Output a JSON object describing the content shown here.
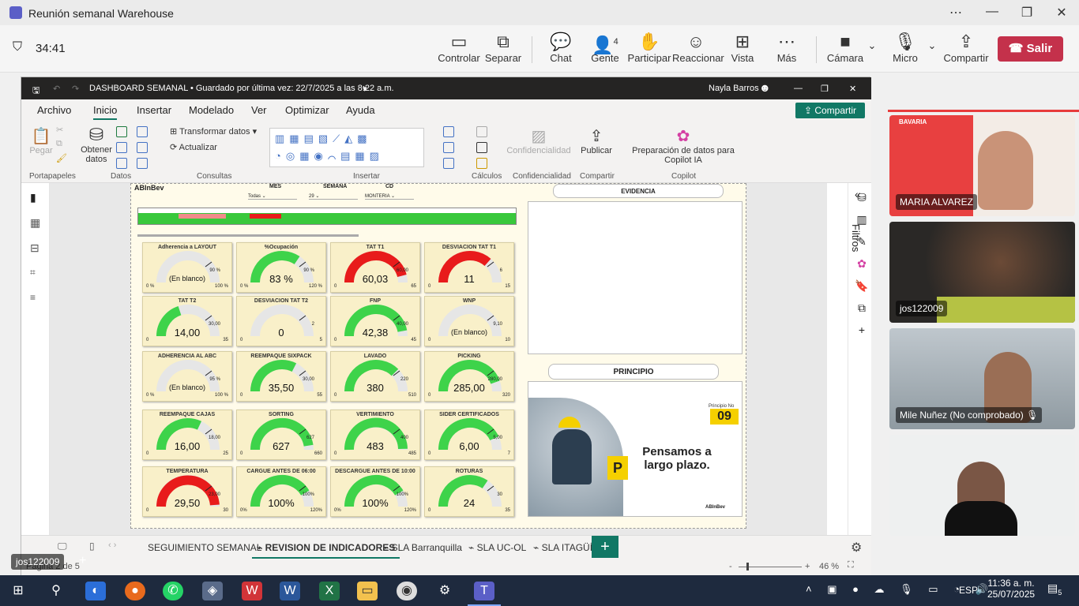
{
  "teams": {
    "window_title": "Reunión semanal Warehouse",
    "timer": "34:41",
    "toolbar": [
      {
        "label": "Controlar",
        "icon": "screen-share-control-icon"
      },
      {
        "label": "Separar",
        "icon": "pop-out-icon"
      },
      {
        "label": "Chat",
        "icon": "chat-icon"
      },
      {
        "label": "Gente",
        "icon": "people-icon",
        "count": "4"
      },
      {
        "label": "Participar",
        "icon": "raise-hand-icon"
      },
      {
        "label": "Reaccionar",
        "icon": "smile-icon"
      },
      {
        "label": "Vista",
        "icon": "grid-view-icon"
      },
      {
        "label": "Más",
        "icon": "more-icon"
      },
      {
        "label": "Cámara",
        "icon": "camera-icon"
      },
      {
        "label": "Micro",
        "icon": "microphone-icon"
      },
      {
        "label": "Compartir",
        "icon": "share-icon"
      }
    ],
    "leave_label": "Salir",
    "participants": [
      {
        "name": "MARIA ALVAREZ"
      },
      {
        "name": "jos122009"
      },
      {
        "name": "Mile Nuñez (No comprobado)"
      },
      {
        "name": ""
      }
    ],
    "presenter_name": "jos122009"
  },
  "pbi": {
    "title": "DASHBOARD SEMANAL • Guardado por última vez: 22/7/2025 a las 8:22 a.m.",
    "user": "Nayla Barros",
    "menu": [
      "Archivo",
      "Inicio",
      "Insertar",
      "Modelado",
      "Ver",
      "Optimizar",
      "Ayuda"
    ],
    "share_label": "Compartir",
    "ribbon": {
      "pegar": "Pegar",
      "obtener": "Obtener datos",
      "transformar": "Transformar datos",
      "actualizar": "Actualizar",
      "confidencialidad": "Confidencialidad",
      "publicar": "Publicar",
      "copilot": "Preparación de datos para Copilot IA",
      "groups": [
        "Portapapeles",
        "Datos",
        "Consultas",
        "Insertar",
        "Cálculos",
        "Confidencialidad",
        "Compartir",
        "Copilot"
      ]
    },
    "filters_label": "Filtros",
    "report": {
      "brand": "ABInBev",
      "slicers": [
        {
          "label": "MES",
          "value": "Todas"
        },
        {
          "label": "SEMANA",
          "value": "29"
        },
        {
          "label": "CD",
          "value": "MONTERIA"
        }
      ],
      "evidencia": "EVIDENCIA",
      "principio": "PRINCIPIO",
      "principio_no": "09",
      "principio_tag": "Principio No",
      "poster_text": "Pensamos a largo plazo.",
      "poster_brand": "ABInBev",
      "gauges": [
        {
          "title": "Adherencia a LAYOUT",
          "value": "(En blanco)",
          "min": "0 %",
          "max": "100 %",
          "target": "90 %",
          "fill": 0,
          "color": "#3ed34a"
        },
        {
          "title": "%Ocupación",
          "value": "83 %",
          "min": "0 %",
          "max": "120 %",
          "target": "90 %",
          "fill": 0.69,
          "color": "#3ed34a"
        },
        {
          "title": "TAT T1",
          "value": "60,03",
          "min": "0",
          "max": "65",
          "target": "60,00",
          "fill": 0.92,
          "color": "#e81b1b"
        },
        {
          "title": "DESVIACION TAT T1",
          "value": "11",
          "min": "0",
          "max": "15",
          "target": "6",
          "fill": 0.73,
          "color": "#e81b1b"
        },
        {
          "title": "TAT T2",
          "value": "14,00",
          "min": "0",
          "max": "35",
          "target": "30,00",
          "fill": 0.4,
          "color": "#3ed34a"
        },
        {
          "title": "DESVIACION TAT T2",
          "value": "0",
          "min": "0",
          "max": "5",
          "target": "2",
          "fill": 0,
          "color": "#3ed34a"
        },
        {
          "title": "FNP",
          "value": "42,38",
          "min": "0",
          "max": "45",
          "target": "40,00",
          "fill": 0.94,
          "color": "#3ed34a"
        },
        {
          "title": "WNP",
          "value": "(En blanco)",
          "min": "0",
          "max": "10",
          "target": "9,10",
          "fill": 0,
          "color": "#3ed34a"
        },
        {
          "title": "ADHERENCIA AL ABC",
          "value": "(En blanco)",
          "min": "0 %",
          "max": "100 %",
          "target": "95 %",
          "fill": 0,
          "color": "#3ed34a"
        },
        {
          "title": "REEMPAQUE SIXPACK",
          "value": "35,50",
          "min": "0",
          "max": "55",
          "target": "30,00",
          "fill": 0.65,
          "color": "#3ed34a"
        },
        {
          "title": "LAVADO",
          "value": "380",
          "min": "0",
          "max": "510",
          "target": "220",
          "fill": 0.75,
          "color": "#3ed34a"
        },
        {
          "title": "PICKING",
          "value": "285,00",
          "min": "0",
          "max": "320",
          "target": "280,00",
          "fill": 0.89,
          "color": "#3ed34a"
        },
        {
          "title": "REEMPAQUE CAJAS",
          "value": "16,00",
          "min": "0",
          "max": "25",
          "target": "18,00",
          "fill": 0.64,
          "color": "#3ed34a"
        },
        {
          "title": "SORTING",
          "value": "627",
          "min": "0",
          "max": "660",
          "target": "627",
          "fill": 0.95,
          "color": "#3ed34a"
        },
        {
          "title": "VERTIMIENTO",
          "value": "483",
          "min": "0",
          "max": "485",
          "target": "400",
          "fill": 0.99,
          "color": "#3ed34a"
        },
        {
          "title": "SIDER CERTIFICADOS",
          "value": "6,00",
          "min": "0",
          "max": "7",
          "target": "5,00",
          "fill": 0.86,
          "color": "#3ed34a"
        },
        {
          "title": "TEMPERATURA",
          "value": "29,50",
          "min": "0",
          "max": "30",
          "target": "23,00",
          "fill": 0.98,
          "color": "#e81b1b"
        },
        {
          "title": "CARGUE ANTES DE 06:00",
          "value": "100%",
          "min": "0%",
          "max": "120%",
          "target": "100%",
          "fill": 0.83,
          "color": "#3ed34a"
        },
        {
          "title": "DESCARGUE ANTES DE 10:00",
          "value": "100%",
          "min": "0%",
          "max": "120%",
          "target": "100%",
          "fill": 0.83,
          "color": "#3ed34a"
        },
        {
          "title": "ROTURAS",
          "value": "24",
          "min": "0",
          "max": "35",
          "target": "30",
          "fill": 0.69,
          "color": "#3ed34a"
        }
      ]
    },
    "tabs": [
      "SEGUIMIENTO SEMANAL",
      "REVISION DE INDICADORES",
      "SLA Barranquilla",
      "SLA UC-OL",
      "SLA ITAGÜÍ"
    ],
    "active_tab": "REVISION DE INDICADORES",
    "page_label": "Página 2 de 5",
    "zoom": "46 %"
  },
  "taskbar": {
    "lang": "ESP",
    "time": "11:36 a. m.",
    "date": "25/07/2025",
    "notif": "5"
  }
}
